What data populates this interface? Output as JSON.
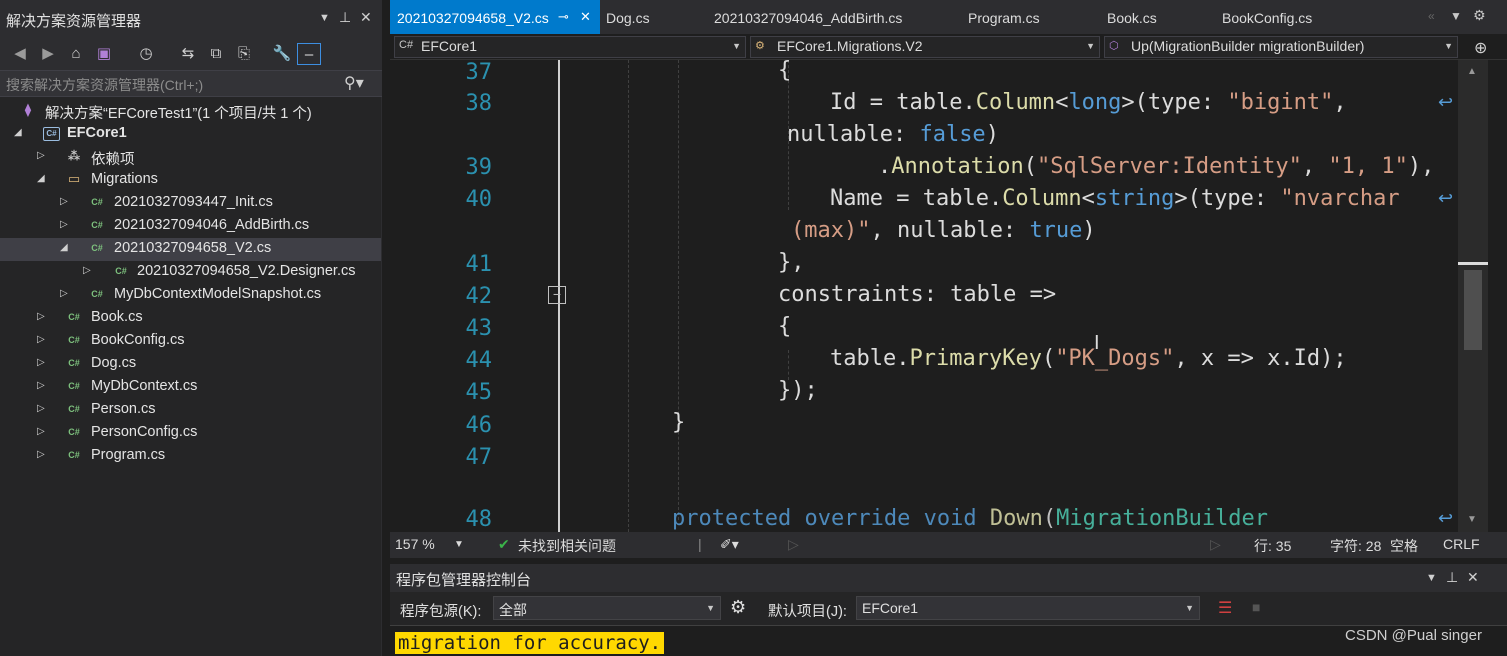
{
  "explorer": {
    "title": "解决方案资源管理器",
    "search_placeholder": "搜索解决方案资源管理器(Ctrl+;)",
    "tree": [
      {
        "label": "解决方案“EFCoreTest1”(1 个项目/共 1 个)",
        "icon": "solution-icon"
      },
      {
        "label": "EFCore1",
        "icon": "project-icon"
      },
      {
        "label": "依赖项",
        "icon": "dependencies-icon"
      },
      {
        "label": "Migrations",
        "icon": "folder-icon"
      },
      {
        "label": "20210327093447_Init.cs",
        "icon": "csharp-file-icon"
      },
      {
        "label": "20210327094046_AddBirth.cs",
        "icon": "csharp-file-icon"
      },
      {
        "label": "20210327094658_V2.cs",
        "icon": "csharp-file-icon"
      },
      {
        "label": "20210327094658_V2.Designer.cs",
        "icon": "csharp-file-icon"
      },
      {
        "label": "MyDbContextModelSnapshot.cs",
        "icon": "csharp-file-icon"
      },
      {
        "label": "Book.cs",
        "icon": "csharp-file-icon"
      },
      {
        "label": "BookConfig.cs",
        "icon": "csharp-file-icon"
      },
      {
        "label": "Dog.cs",
        "icon": "csharp-file-icon"
      },
      {
        "label": "MyDbContext.cs",
        "icon": "csharp-file-icon"
      },
      {
        "label": "Person.cs",
        "icon": "csharp-file-icon"
      },
      {
        "label": "PersonConfig.cs",
        "icon": "csharp-file-icon"
      },
      {
        "label": "Program.cs",
        "icon": "csharp-file-icon"
      }
    ]
  },
  "editor": {
    "tabs": [
      "20210327094658_V2.cs",
      "Dog.cs",
      "20210327094046_AddBirth.cs",
      "Program.cs",
      "Book.cs",
      "BookConfig.cs"
    ],
    "nav": {
      "project": "EFCore1",
      "class": "EFCore1.Migrations.V2",
      "member": "Up(MigrationBuilder migrationBuilder)"
    },
    "line_numbers": [
      "37",
      "38",
      "39",
      "40",
      "41",
      "42",
      "43",
      "44",
      "45",
      "46",
      "47",
      "48"
    ],
    "code": {
      "l37": "{",
      "l38a_name": "Id = table.",
      "l38a_method": "Column",
      "l38a_lt": "<",
      "l38a_type": "long",
      "l38a_gt": ">(type: ",
      "l38a_str": "\"bigint\"",
      "l38a_end": ",",
      "l38b_name": "nullable: ",
      "l38b_val": "false",
      "l38b_end": ")",
      "l39_pre": ".",
      "l39_method": "Annotation",
      "l39_open": "(",
      "l39_str1": "\"SqlServer:Identity\"",
      "l39_comma": ", ",
      "l39_str2": "\"1, 1\"",
      "l39_end": "),",
      "l40a_name": "Name = table.",
      "l40a_method": "Column",
      "l40a_lt": "<",
      "l40a_type": "string",
      "l40a_gt": ">(type: ",
      "l40a_str": "\"nvarchar",
      "l40b_str": "(max)\"",
      "l40b_mid": ", nullable: ",
      "l40b_val": "true",
      "l40b_end": ")",
      "l41": "},",
      "l42": "constraints: table =>",
      "l43": "{",
      "l44_pre": "table.",
      "l44_method": "PrimaryKey",
      "l44_open": "(",
      "l44_str": "\"PK_Dogs\"",
      "l44_end": ", x => x.Id);",
      "l45": "});",
      "l46": "}",
      "l48_kw": "protected override void ",
      "l48_name": "Down",
      "l48_open": "(",
      "l48_type": "MigrationBuilder"
    }
  },
  "status": {
    "zoom": "157 %",
    "issues": "未找到相关问题",
    "line": "行: 35",
    "col": "字符: 28",
    "spaces": "空格",
    "eol": "CRLF"
  },
  "pmc": {
    "title": "程序包管理器控制台",
    "source_label": "程序包源(K):",
    "source_value": "全部",
    "project_label": "默认项目(J):",
    "project_value": "EFCore1",
    "console_text": "migration for accuracy."
  },
  "watermark": "CSDN @Pual singer",
  "colors": {
    "keyword": "#569cd6",
    "type": "#4ec9b0",
    "string": "#d69d85",
    "method": "#dcdcaa",
    "line_number": "#2b91af",
    "accent": "#007acc",
    "warning_bg": "#ffd800"
  }
}
